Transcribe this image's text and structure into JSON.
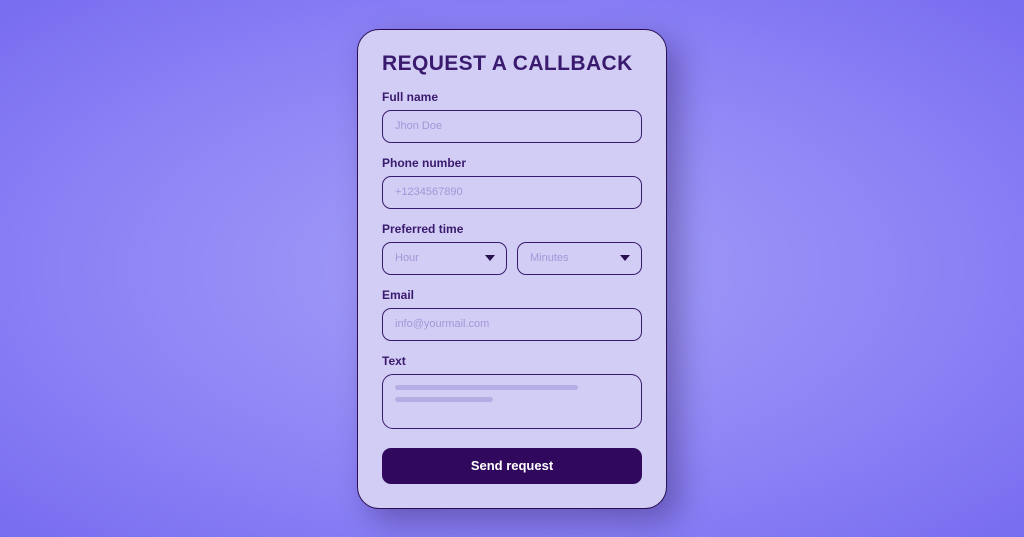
{
  "form": {
    "title": "REQUEST A CALLBACK",
    "fullname": {
      "label": "Full name",
      "placeholder": "Jhon Doe"
    },
    "phone": {
      "label": "Phone number",
      "placeholder": "+1234567890"
    },
    "preferred_time": {
      "label": "Preferred time",
      "hour_placeholder": "Hour",
      "minutes_placeholder": "Minutes"
    },
    "email": {
      "label": "Email",
      "placeholder": "info@yourmail.com"
    },
    "text": {
      "label": "Text"
    },
    "submit_label": "Send request"
  }
}
